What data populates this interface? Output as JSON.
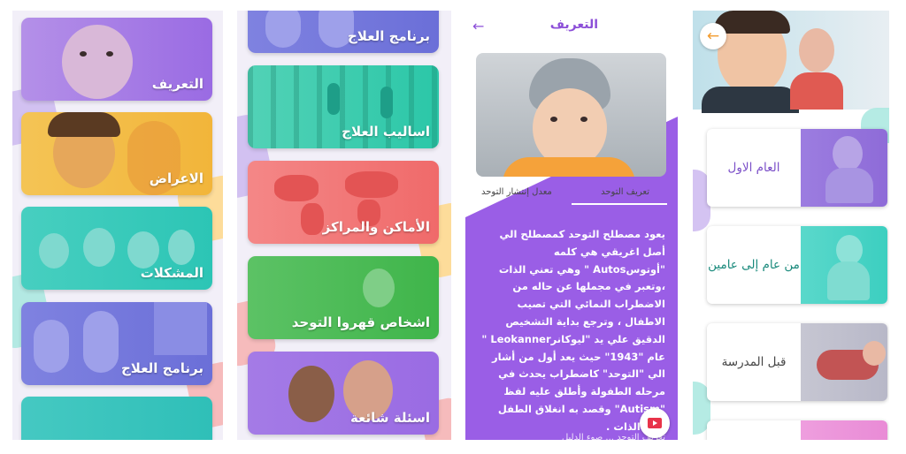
{
  "screen1": {
    "cards": [
      {
        "label": "التعريف",
        "color": "#9a6be3"
      },
      {
        "label": "الاعراض",
        "color": "#f2b53a"
      },
      {
        "label": "المشكلات",
        "color": "#2cc5b5"
      },
      {
        "label": "برنامج العلاج",
        "color": "#6b6fd8"
      },
      {
        "label": "",
        "color": "#2fbfb8"
      }
    ]
  },
  "screen2": {
    "cards": [
      {
        "label": "برنامج العلاج",
        "color": "#6b6fd8"
      },
      {
        "label": "اساليب العلاج",
        "color": "#2bc7a8"
      },
      {
        "label": "الأماكن والمراكز",
        "color": "#f06a6a"
      },
      {
        "label": "اشخاص قهروا التوحد",
        "color": "#3fb54a"
      },
      {
        "label": "اسئلة شائعة",
        "color": "#9a6be3"
      }
    ]
  },
  "screen3": {
    "title": "التعريف",
    "back_icon": "arrow-left-icon",
    "tab_active": "تعريف التوحد",
    "tab_other": "معدل إنتشار التوحد",
    "body": "يعود مصطلح التوحد كمصطلح الي أصل اغريقي هي كلمه \"أوتوسAutos \" وهي تعني الذات ،وتعبر في مجملها عن حاله من الاضطراب النمائي التي تصيب الاطفال ، وترجع بداية التشخيص الدقيق علي يد \"ليوكانرLeokanner \" عام \"1943\" حيث يعد أول من أشار الي \"التوحد\" كاضطراب يحدث في مرحله الطفولة وأطلق عليه لفظ \"Autism\" وقصد به انغلاق الطفل على الذات .",
    "footer_text": "تعريف التوحد ... صوء الدليل",
    "accent": "#9a5ee6",
    "fab_icon": "video-play-icon"
  },
  "screen4": {
    "back_icon": "arrow-left-icon",
    "stages": [
      {
        "label": "العام الاول",
        "color": "#8e6bd8"
      },
      {
        "label": "من عام إلى عامين",
        "color": "#3ccfc0"
      },
      {
        "label": "قبل المدرسة",
        "color": "#b8b8c8"
      },
      {
        "label": "",
        "color": "#e98bd6"
      }
    ]
  }
}
